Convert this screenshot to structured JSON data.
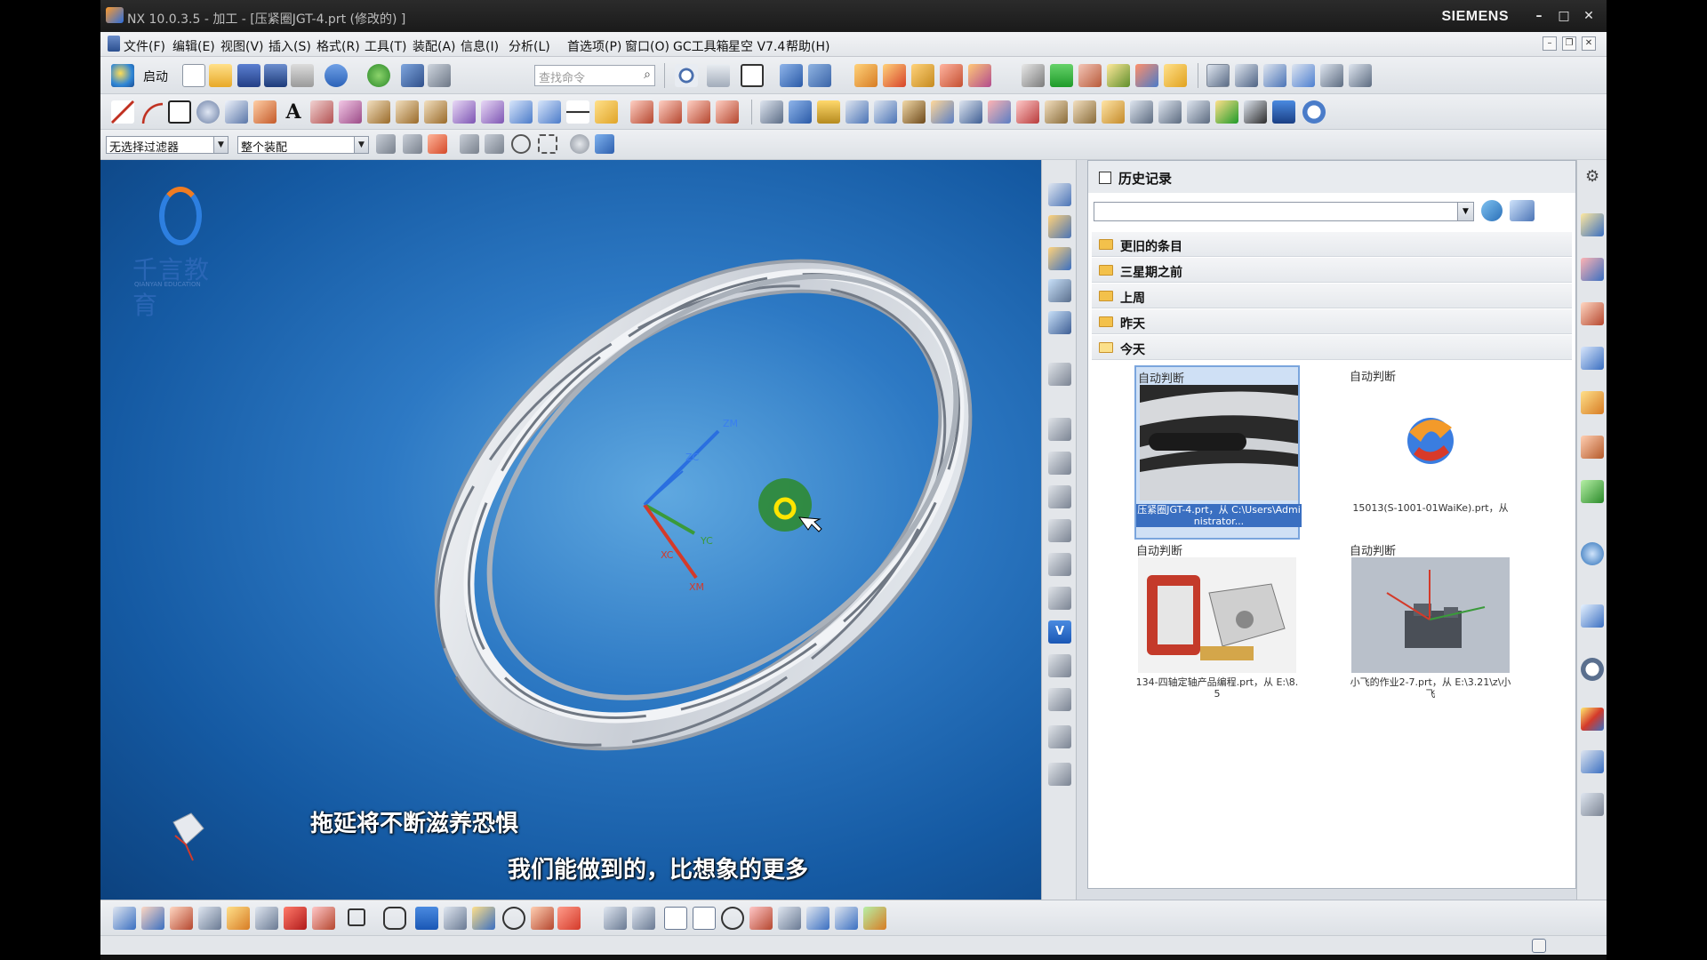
{
  "window": {
    "title": "NX 10.0.3.5 - 加工 - [压紧圈JGT-4.prt  (修改的) ]",
    "brand": "SIEMENS",
    "controls": {
      "minimize": "–",
      "maximize": "□",
      "close": "✕"
    }
  },
  "menu": {
    "items": [
      "文件(F)",
      "编辑(E)",
      "视图(V)",
      "插入(S)",
      "格式(R)",
      "工具(T)",
      "装配(A)",
      "信息(I)",
      "分析(L)",
      "首选项(P)",
      "窗口(O)",
      "GC工具箱",
      "星空 V7.4",
      "帮助(H)"
    ]
  },
  "toolbar": {
    "launch_label": "启动",
    "search_placeholder": "查找命令",
    "filter_select": "无选择过滤器",
    "assembly_select": "整个装配"
  },
  "viewport": {
    "logo_text": "千言教育",
    "logo_sub": "QIANYAN EDUCATION",
    "subtitle_1": "拖延将不断滋养恐惧",
    "subtitle_2": "我们能做到的，比想象的更多",
    "axis_labels": {
      "zm": "ZM",
      "zc": "ZC",
      "yc": "YC",
      "xc": "XC",
      "xm": "XM"
    }
  },
  "history_panel": {
    "title": "历史记录",
    "folders": [
      "更旧的条目",
      "三星期之前",
      "上周",
      "昨天",
      "今天"
    ],
    "items": [
      {
        "label": "自动判断",
        "caption": "压紧圈JGT-4.prt，从 C:\\Users\\Administrator...",
        "selected": true
      },
      {
        "label": "自动判断",
        "caption": "15013(S-1001-01WaiKe).prt，从",
        "selected": false
      },
      {
        "label": "自动判断",
        "caption": "134-四轴定轴产品编程.prt，从 E:\\8.5",
        "selected": false
      },
      {
        "label": "自动判断",
        "caption": "小飞的作业2-7.prt，从 E:\\3.21\\z\\小飞",
        "selected": false
      }
    ]
  },
  "colors": {
    "title_bg": "#1a1a1a",
    "viewport_center": "#5fa8e0",
    "viewport_edge": "#0c427f",
    "selection": "#3a6fc1"
  }
}
